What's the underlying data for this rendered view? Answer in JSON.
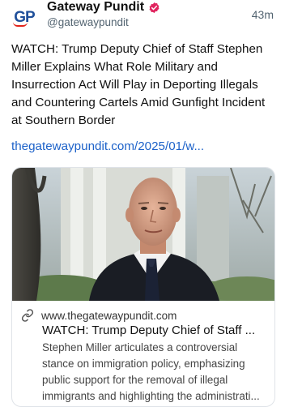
{
  "account": {
    "name": "Gateway Pundit",
    "handle": "@gatewaypundit",
    "avatar_text": "GP",
    "time": "43m"
  },
  "post": {
    "text": "WATCH: Trump Deputy Chief of Staff Stephen Miller Explains What Role Military and Insurrection Act Will Play in Deporting Illegals and Countering Cartels Amid Gunfight Incident at Southern Border",
    "link": "thegatewaypundit.com/2025/01/w..."
  },
  "card": {
    "domain": "www.thegatewaypundit.com",
    "title": "WATCH: Trump Deputy Chief of Staff ...",
    "description": "Stephen Miller articulates a controversial stance on immigration policy, emphasizing public support for the removal of illegal immigrants and highlighting the administrati..."
  },
  "colors": {
    "link": "#1d62c9",
    "verified_badge": "#e0245e",
    "secondary_text": "#536471"
  },
  "icons": {
    "verified": "verified-badge-icon",
    "link": "link-icon"
  }
}
